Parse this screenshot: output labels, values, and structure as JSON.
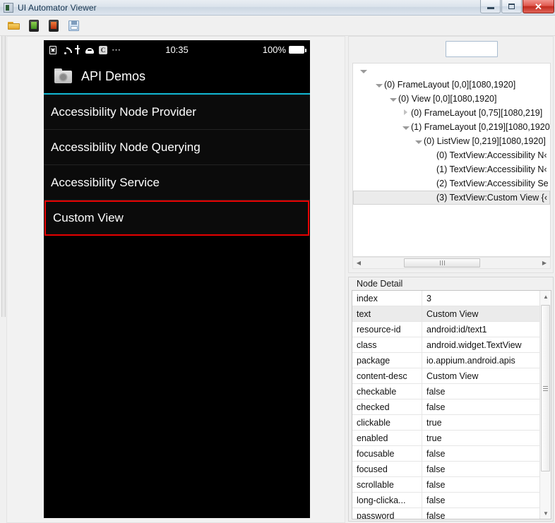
{
  "window": {
    "title": "UI Automator Viewer",
    "icon": "app-window-icon",
    "controls": {
      "minimize": "minimize-button",
      "restore": "restore-button",
      "close": "✕"
    }
  },
  "toolbar": {
    "buttons": [
      {
        "name": "open-file-button",
        "icon": "folder-open-icon"
      },
      {
        "name": "device-screenshot-button",
        "icon": "device-green-icon"
      },
      {
        "name": "device-screenshot-compressed-button",
        "icon": "device-red-icon"
      },
      {
        "name": "save-button",
        "icon": "save-disk-icon"
      }
    ]
  },
  "device_screen": {
    "statusbar": {
      "icons": [
        "no-sim-icon",
        "wifi-icon",
        "usb-icon",
        "android-robot-icon",
        "app-c-icon",
        "more-dots-icon"
      ],
      "app_icon_letter": "C",
      "time": "10:35",
      "battery_percent": "100%"
    },
    "appbar": {
      "icon": "api-demos-app-icon",
      "title": "API Demos"
    },
    "list_items": [
      {
        "label": "Accessibility Node Provider",
        "selected": false
      },
      {
        "label": "Accessibility Node Querying",
        "selected": false
      },
      {
        "label": "Accessibility Service",
        "selected": false
      },
      {
        "label": "Custom View",
        "selected": true
      }
    ],
    "selection_color": "#e60000",
    "accent_color": "#12b8d4"
  },
  "tree_panel": {
    "search_value": "",
    "search_placeholder": "",
    "nodes": [
      {
        "depth": 0,
        "twisty": "open",
        "label": "",
        "selected": false
      },
      {
        "depth": 1,
        "twisty": "open",
        "label": "(0) FrameLayout [0,0][1080,1920]",
        "selected": false
      },
      {
        "depth": 2,
        "twisty": "open",
        "label": "(0) View [0,0][1080,1920]",
        "selected": false
      },
      {
        "depth": 3,
        "twisty": "closed",
        "label": "(0) FrameLayout [0,75][1080,219]",
        "selected": false
      },
      {
        "depth": 3,
        "twisty": "open",
        "label": "(1) FrameLayout [0,219][1080,1920",
        "selected": false
      },
      {
        "depth": 4,
        "twisty": "open",
        "label": "(0) ListView [0,219][1080,1920]",
        "selected": false
      },
      {
        "depth": 5,
        "twisty": "none",
        "label": "(0) TextView:Accessibility N‹",
        "selected": false
      },
      {
        "depth": 5,
        "twisty": "none",
        "label": "(1) TextView:Accessibility N‹",
        "selected": false
      },
      {
        "depth": 5,
        "twisty": "none",
        "label": "(2) TextView:Accessibility Se",
        "selected": false
      },
      {
        "depth": 5,
        "twisty": "none",
        "label": "(3) TextView:Custom View {‹",
        "selected": true
      }
    ],
    "hscrollbar": {
      "left_arrow": "◀",
      "right_arrow": "▶"
    }
  },
  "node_detail": {
    "legend": "Node Detail",
    "rows": [
      {
        "key": "index",
        "value": "3",
        "highlight": false
      },
      {
        "key": "text",
        "value": "Custom View",
        "highlight": true
      },
      {
        "key": "resource-id",
        "value": "android:id/text1",
        "highlight": false
      },
      {
        "key": "class",
        "value": "android.widget.TextView",
        "highlight": false
      },
      {
        "key": "package",
        "value": "io.appium.android.apis",
        "highlight": false
      },
      {
        "key": "content-desc",
        "value": "Custom View",
        "highlight": false
      },
      {
        "key": "checkable",
        "value": "false",
        "highlight": false
      },
      {
        "key": "checked",
        "value": "false",
        "highlight": false
      },
      {
        "key": "clickable",
        "value": "true",
        "highlight": false
      },
      {
        "key": "enabled",
        "value": "true",
        "highlight": false
      },
      {
        "key": "focusable",
        "value": "false",
        "highlight": false
      },
      {
        "key": "focused",
        "value": "false",
        "highlight": false
      },
      {
        "key": "scrollable",
        "value": "false",
        "highlight": false
      },
      {
        "key": "long-clicka...",
        "value": "false",
        "highlight": false
      },
      {
        "key": "password",
        "value": "false",
        "highlight": false
      }
    ],
    "vscrollbar": {
      "up_arrow": "▲",
      "down_arrow": "▼"
    }
  }
}
